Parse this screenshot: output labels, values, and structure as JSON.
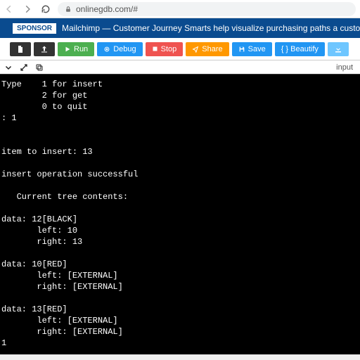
{
  "browser": {
    "url": "onlinegdb.com/#"
  },
  "banner": {
    "sponsor_badge": "SPONSOR",
    "text": "Mailchimp — Customer Journey Smarts help visualize purchasing paths a customer may ta"
  },
  "toolbar": {
    "run": "Run",
    "debug": "Debug",
    "stop": "Stop",
    "share": "Share",
    "save": "Save",
    "beautify": "{ } Beautify"
  },
  "console": {
    "label": "input",
    "output": "Type    1 for insert\n        2 for get\n        0 to quit\n: 1\n\n\nitem to insert: 13\n\ninsert operation successful\n\n   Current tree contents:\n\ndata: 12[BLACK]\n       left: 10\n       right: 13\n\ndata: 10[RED]\n       left: [EXTERNAL]\n       right: [EXTERNAL]\n\ndata: 13[RED]\n       left: [EXTERNAL]\n       right: [EXTERNAL]\n1"
  }
}
